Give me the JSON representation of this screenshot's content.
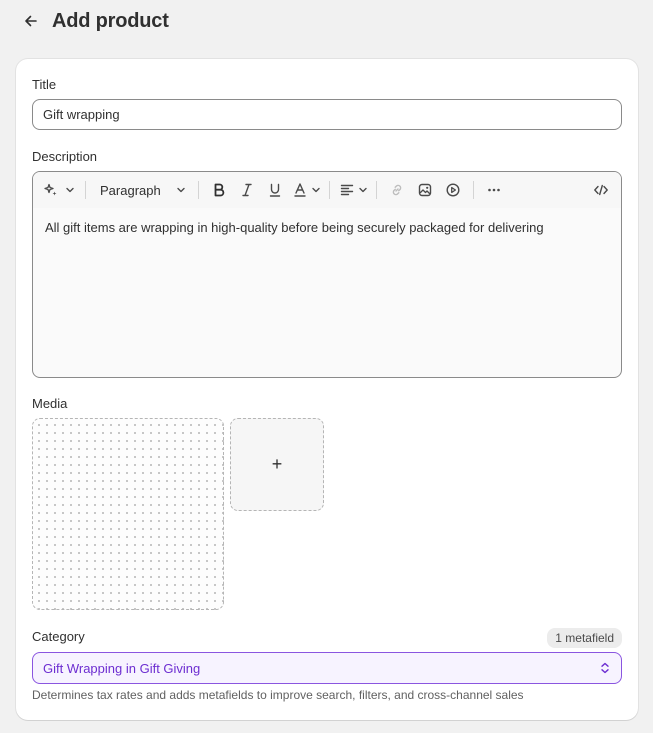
{
  "header": {
    "title": "Add product",
    "back_icon": "arrow-left-icon"
  },
  "title_field": {
    "label": "Title",
    "value": "Gift wrapping"
  },
  "description_field": {
    "label": "Description",
    "toolbar": {
      "ai_icon": "sparkle-icon",
      "paragraph_label": "Paragraph",
      "buttons": [
        "bold-icon",
        "italic-icon",
        "underline-icon",
        "text-color-icon",
        "align-icon",
        "link-icon",
        "image-icon",
        "video-icon",
        "more-icon",
        "code-icon"
      ]
    },
    "content": "All gift items are wrapping in high-quality before being securely packaged for delivering"
  },
  "media": {
    "label": "Media",
    "add_symbol": "+"
  },
  "category": {
    "label": "Category",
    "badge": "1 metafield",
    "value": "Gift Wrapping in Gift Giving",
    "help_text": "Determines tax rates and adds metafields to improve search, filters, and cross-channel sales"
  },
  "colors": {
    "accent": "#6d2ed1",
    "accent_bg": "#f7f3ff",
    "page_bg": "#f1f1f1"
  }
}
